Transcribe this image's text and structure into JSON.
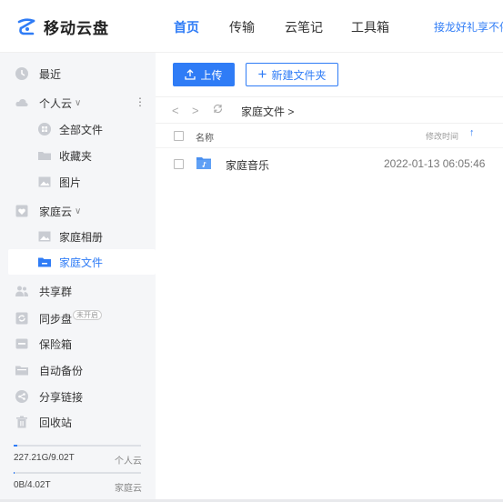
{
  "header": {
    "brand": "移动云盘",
    "nav": [
      "首页",
      "传输",
      "云笔记",
      "工具箱"
    ],
    "active_nav": "首页",
    "promo": "接龙好礼享不停"
  },
  "sidebar": {
    "recent": "最近",
    "personal": "个人云",
    "personal_children": [
      "全部文件",
      "收藏夹",
      "图片"
    ],
    "family": "家庭云",
    "family_children": [
      "家庭相册",
      "家庭文件"
    ],
    "share_group": "共享群",
    "sync": "同步盘",
    "sync_badge": "未开启",
    "safe": "保险箱",
    "backup": "自动备份",
    "share_link": "分享链接",
    "recycle": "回收站",
    "storage": [
      {
        "amount": "227.21G/9.02T",
        "label": "个人云",
        "fraction": 0.025
      },
      {
        "amount": "0B/4.02T",
        "label": "家庭云",
        "fraction": 0.0
      }
    ]
  },
  "toolbar": {
    "upload": "上传",
    "new_folder": "新建文件夹"
  },
  "breadcrumb": {
    "path": "家庭文件 >"
  },
  "table": {
    "col_name": "名称",
    "col_modified": "修改时间",
    "sort_icon": "↑",
    "rows": [
      {
        "name": "家庭音乐",
        "modified": "2022-01-13 06:05:46"
      }
    ]
  },
  "colors": {
    "accent": "#2f7cf6",
    "sidebar_bg": "#f5f6f8"
  }
}
